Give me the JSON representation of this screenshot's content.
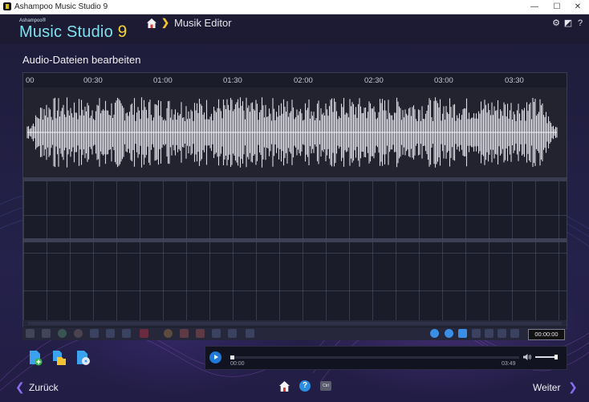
{
  "window": {
    "title": "Ashampoo Music Studio 9",
    "controls": [
      "minimize",
      "maximize",
      "close"
    ],
    "minimize_glyph": "—",
    "maximize_glyph": "☐",
    "close_glyph": "✕"
  },
  "header": {
    "brand_small": "Ashampoo®",
    "brand_name": "Music Studio",
    "brand_version": "9",
    "breadcrumb": "Musik Editor",
    "breadcrumb_icons": [
      "home-icon",
      "chevron-right-icon"
    ],
    "right_icons": [
      "gear-icon",
      "skin-icon",
      "help-icon"
    ],
    "gear_glyph": "⚙",
    "skin_glyph": "◩",
    "help_glyph": "?",
    "arrow_glyph": "❯"
  },
  "editor": {
    "section_title": "Audio-Dateien bearbeiten",
    "time_ticks": [
      "00",
      "00:30",
      "01:00",
      "01:30",
      "02:00",
      "02:30",
      "03:00",
      "03:30"
    ],
    "timecode": "00:00:00"
  },
  "toolbar": {
    "icons": [
      "speaker-icon",
      "list-icon",
      "check-icon",
      "circle-icon",
      "move-icon",
      "arrows-icon",
      "rewind-icon",
      "record-icon",
      "fx-icon",
      "fade-in-icon",
      "fade-out-icon",
      "normalize-icon",
      "split-icon",
      "export-icon",
      "zoom-in-icon",
      "zoom-out-icon",
      "undo-icon",
      "redo-icon",
      "copy-icon",
      "cut-icon",
      "paste-icon"
    ]
  },
  "add_buttons": [
    "add-file-icon",
    "add-folder-icon",
    "add-cd-icon"
  ],
  "player": {
    "time_start": "00:00",
    "time_end": "03:49",
    "progress": 0.0,
    "volume": 0.9
  },
  "footer": {
    "back_label": "Zurück",
    "next_label": "Weiter",
    "back_arrow": "❮",
    "next_arrow": "❯",
    "help_glyph": "?",
    "ctrl_label": "Ctrl"
  },
  "colors": {
    "accent_blue": "#1e7ad6",
    "brand_cyan": "#7fe0ee",
    "brand_yellow": "#f2d33a",
    "nav_purple": "#8a6cf0"
  }
}
